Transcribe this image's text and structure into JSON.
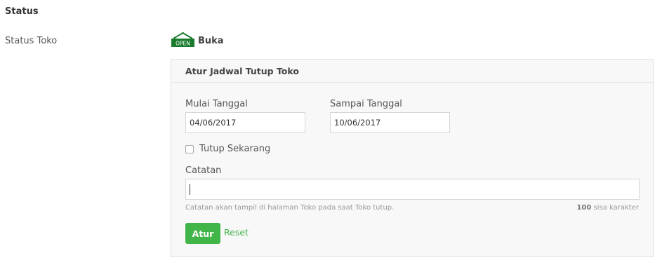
{
  "section": {
    "title": "Status"
  },
  "status_row": {
    "label": "Status Toko",
    "sign_text": "OPEN",
    "value": "Buka"
  },
  "schedule_panel": {
    "title": "Atur Jadwal Tutup Toko",
    "start_label": "Mulai Tanggal",
    "start_value": "04/06/2017",
    "end_label": "Sampai Tanggal",
    "end_value": "10/06/2017",
    "close_now_label": "Tutup Sekarang",
    "close_now_checked": false,
    "note_label": "Catatan",
    "note_value": "",
    "note_hint": "Catatan akan tampil di halaman Toko pada saat Toko tutup.",
    "char_count": "100",
    "char_count_suffix": "sisa karakter",
    "submit_label": "Atur",
    "reset_label": "Reset"
  },
  "colors": {
    "accent": "#42b549",
    "open_sign": "#1b7c2e",
    "panel_bg": "#f8f8f8",
    "border": "#e0e0e0"
  },
  "icons": {
    "status": "open-sign-icon"
  }
}
